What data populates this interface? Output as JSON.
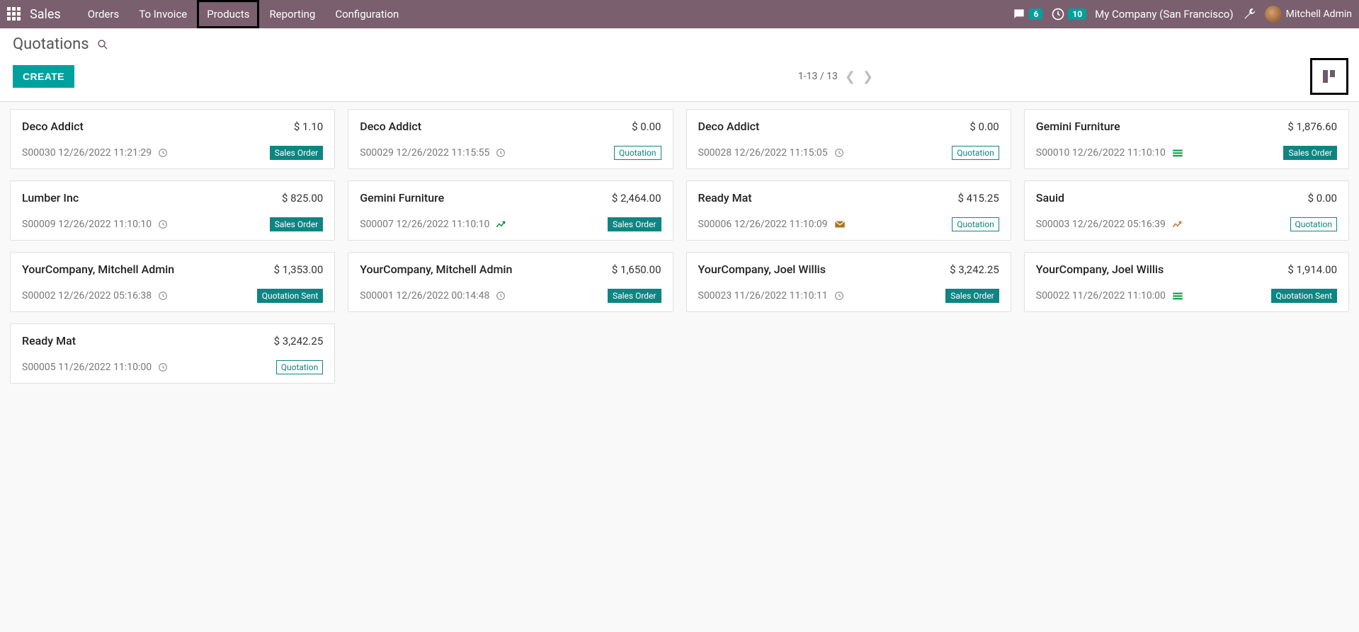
{
  "nav": {
    "brand": "Sales",
    "items": [
      "Orders",
      "To Invoice",
      "Products",
      "Reporting",
      "Configuration"
    ],
    "chat_count": "6",
    "clock_count": "10",
    "company": "My Company (San Francisco)",
    "user": "Mitchell Admin"
  },
  "page": {
    "title": "Quotations",
    "create": "CREATE",
    "pager": "1-13 / 13"
  },
  "cards": [
    {
      "title": "Deco Addict",
      "amount": "$ 1.10",
      "ref": "S00030 12/26/2022 11:21:29",
      "icon": "clock",
      "extra": "",
      "status": "Sales Order",
      "status_class": "status-salesorder"
    },
    {
      "title": "Deco Addict",
      "amount": "$ 0.00",
      "ref": "S00029 12/26/2022 11:15:55",
      "icon": "clock",
      "extra": "",
      "status": "Quotation",
      "status_class": "status-quotation"
    },
    {
      "title": "Deco Addict",
      "amount": "$ 0.00",
      "ref": "S00028 12/26/2022 11:15:05",
      "icon": "clock",
      "extra": "",
      "status": "Quotation",
      "status_class": "status-quotation"
    },
    {
      "title": "Gemini Furniture",
      "amount": "$ 1,876.60",
      "ref": "S00010 12/26/2022 11:10:10",
      "icon": "bars",
      "extra": "",
      "status": "Sales Order",
      "status_class": "status-salesorder"
    },
    {
      "title": "Lumber Inc",
      "amount": "$ 825.00",
      "ref": "S00009 12/26/2022 11:10:10",
      "icon": "clock",
      "extra": "",
      "status": "Sales Order",
      "status_class": "status-salesorder"
    },
    {
      "title": "Gemini Furniture",
      "amount": "$ 2,464.00",
      "ref": "S00007 12/26/2022 11:10:10",
      "icon": "chart",
      "extra": "",
      "status": "Sales Order",
      "status_class": "status-salesorder"
    },
    {
      "title": "Ready Mat",
      "amount": "$ 415.25",
      "ref": "S00006 12/26/2022 11:10:09",
      "icon": "mail",
      "extra": "",
      "status": "Quotation",
      "status_class": "status-quotation"
    },
    {
      "title": "Sauid",
      "amount": "$ 0.00",
      "ref": "S00003 12/26/2022 05:16:39",
      "icon": "chart-orange",
      "extra": "",
      "status": "Quotation",
      "status_class": "status-quotation"
    },
    {
      "title": "YourCompany, Mitchell Admin",
      "amount": "$ 1,353.00",
      "ref": "S00002 12/26/2022 05:16:38",
      "icon": "clock",
      "extra": "",
      "status": "Quotation Sent",
      "status_class": "status-quotationsent"
    },
    {
      "title": "YourCompany, Mitchell Admin",
      "amount": "$ 1,650.00",
      "ref": "S00001 12/26/2022 00:14:48",
      "icon": "clock",
      "extra": "",
      "status": "Sales Order",
      "status_class": "status-salesorder"
    },
    {
      "title": "YourCompany, Joel Willis",
      "amount": "$ 3,242.25",
      "ref": "S00023 11/26/2022 11:10:11",
      "icon": "clock",
      "extra": "",
      "status": "Sales Order",
      "status_class": "status-salesorder"
    },
    {
      "title": "YourCompany, Joel Willis",
      "amount": "$ 1,914.00",
      "ref": "S00022 11/26/2022 11:10:00",
      "icon": "bars",
      "extra": "",
      "status": "Quotation Sent",
      "status_class": "status-quotationsent"
    },
    {
      "title": "Ready Mat",
      "amount": "$ 3,242.25",
      "ref": "S00005 11/26/2022 11:10:00",
      "icon": "clock",
      "extra": "",
      "status": "Quotation",
      "status_class": "status-quotation"
    }
  ]
}
